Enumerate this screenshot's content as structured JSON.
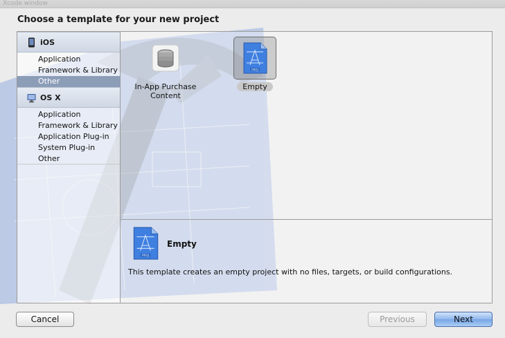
{
  "window": {
    "ghost_title": "Xcode window"
  },
  "heading": "Choose a template for your new project",
  "sidebar": {
    "groups": [
      {
        "label": "iOS",
        "icon": "iphone-icon",
        "items": [
          {
            "label": "Application",
            "selected": false
          },
          {
            "label": "Framework & Library",
            "selected": false
          },
          {
            "label": "Other",
            "selected": true
          }
        ]
      },
      {
        "label": "OS X",
        "icon": "mac-icon",
        "items": [
          {
            "label": "Application",
            "selected": false
          },
          {
            "label": "Framework & Library",
            "selected": false
          },
          {
            "label": "Application Plug-in",
            "selected": false
          },
          {
            "label": "System Plug-in",
            "selected": false
          },
          {
            "label": "Other",
            "selected": false
          }
        ]
      }
    ]
  },
  "templates": [
    {
      "label_line1": "In-App Purchase",
      "label_line2": "Content",
      "icon": "database-icon",
      "selected": false
    },
    {
      "label_line1": "Empty",
      "label_line2": "",
      "icon": "xcode-project-icon",
      "selected": true
    }
  ],
  "detail": {
    "name": "Empty",
    "description": "This template creates an empty project with no files, targets, or build configurations.",
    "icon": "xcode-project-icon"
  },
  "buttons": {
    "cancel": "Cancel",
    "previous": "Previous",
    "next": "Next"
  },
  "colors": {
    "selection": "#8c9db8",
    "primary_button": "#76a6e6",
    "blueprint": "#3f6fcf"
  }
}
